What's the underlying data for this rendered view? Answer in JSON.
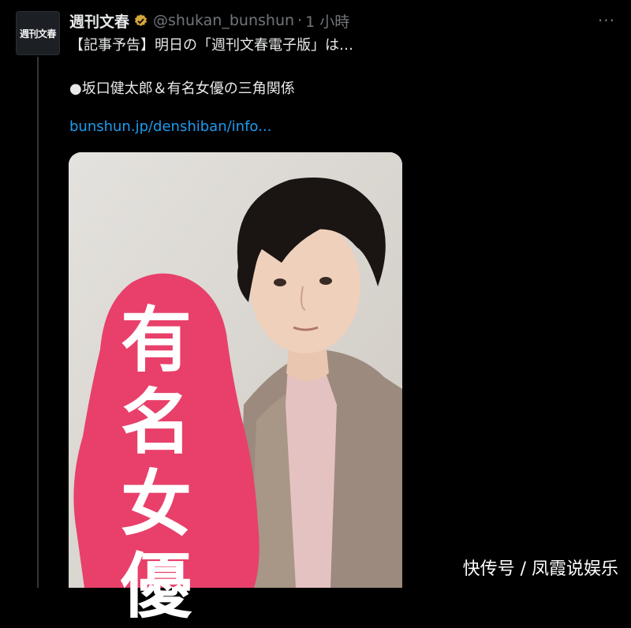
{
  "tweet": {
    "avatar_text": "週刊文春",
    "display_name": "週刊文春",
    "handle": "@shukan_bunshun",
    "separator": "·",
    "time": "1 小時",
    "more_label": "···",
    "text_line1": "【記事予告】明日の「週刊文春電子版」は…",
    "text_line2": "●坂口健太郎＆有名女優の三角関係",
    "link": "bunshun.jp/denshiban/info..."
  },
  "media": {
    "overlay_chars": [
      "有",
      "名",
      "女",
      "優"
    ],
    "colors": {
      "pink": "#e8406a",
      "background": "#d9d5cf"
    }
  },
  "watermark": "快传号 / 凤霞说娱乐",
  "colors": {
    "link": "#1d9bf0",
    "muted": "#71767b",
    "verified": "#d4a73c"
  }
}
